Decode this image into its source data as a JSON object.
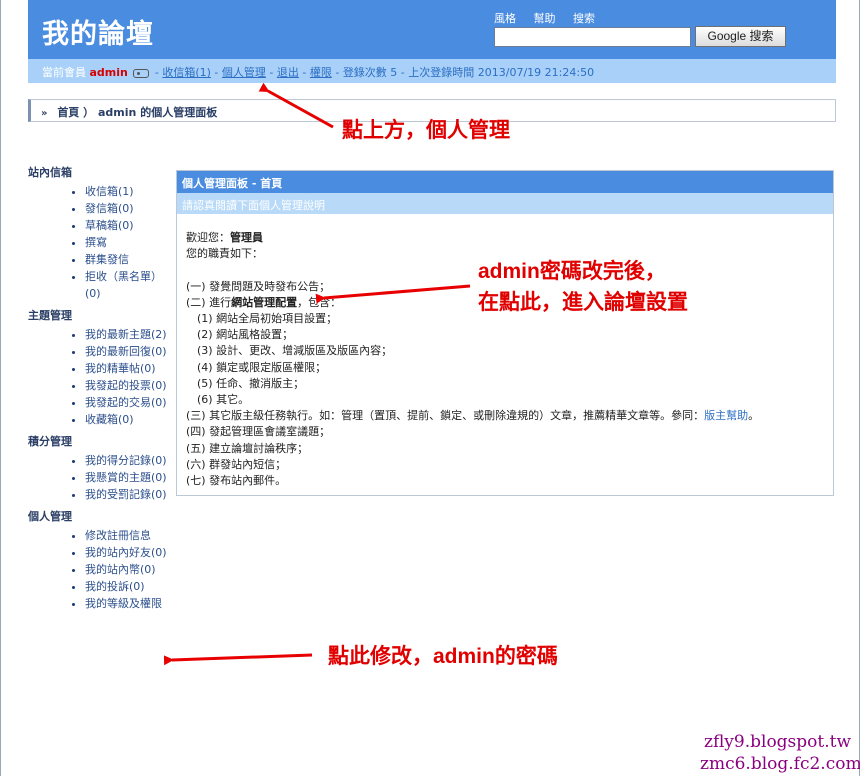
{
  "header": {
    "site_title": "我的論壇",
    "links": [
      "風格",
      "幫助",
      "搜索"
    ],
    "search_placeholder": "",
    "search_button": "Google 搜索"
  },
  "userbar": {
    "prefix": "當前會員",
    "username": "admin",
    "inbox": "收信箱(1)",
    "personal": "個人管理",
    "logout": "退出",
    "permissions": "權限",
    "login_count": "登錄次數 5",
    "last_login": "上次登錄時間 2013/07/19 21:24:50",
    "sep": " - "
  },
  "breadcrumb": {
    "chevron": "»",
    "home": "首頁",
    "sep": "）",
    "title": "admin 的個人管理面板"
  },
  "sidebar": {
    "sections": [
      {
        "title": "站內信箱",
        "items": [
          "收信箱(1)",
          "發信箱(0)",
          "草稿箱(0)",
          "撰寫",
          "群集發信",
          "拒收（黑名單）(0)"
        ]
      },
      {
        "title": "主題管理",
        "items": [
          "我的最新主題(2)",
          "我的最新回復(0)",
          "我的精華帖(0)",
          "我發起的投票(0)",
          "我發起的交易(0)",
          "收藏箱(0)"
        ]
      },
      {
        "title": "積分管理",
        "items": [
          "我的得分記錄(0)",
          "我懸賞的主題(0)",
          "我的受罰記錄(0)"
        ]
      },
      {
        "title": "個人管理",
        "items": [
          "修改註冊信息",
          "我的站內好友(0)",
          "我的站內幣(0)",
          "我的投訴(0)",
          "我的等級及權限"
        ]
      }
    ]
  },
  "panel": {
    "title": "個人管理面板 - 首頁",
    "subtitle": "請認真閱讀下面個人管理說明",
    "welcome_prefix": "歡迎您：",
    "welcome_role": "管理員",
    "duties_intro": "您的職責如下：",
    "lines": [
      "(一) 發覺問題及時發布公告；",
      "(二) 進行網站管理配置，包含：",
      "(1) 網站全局初始項目設置；",
      "(2) 網站風格設置；",
      "(3) 設計、更改、增減版區及版區內容；",
      "(4) 鎖定或限定版區權限；",
      "(5) 任命、撤消版主；",
      "(6) 其它。",
      "(三) 其它版主級任務執行。如：管理（置頂、提前、鎖定、或刪除違規的）文章，推薦精華文章等。參同：",
      "(四) 發起管理區會議室議題；",
      "(五) 建立論壇討論秩序；",
      "(六) 群發站內短信；",
      "(七) 發布站內郵件。"
    ],
    "help_link": "版主幫助",
    "help_end": "。",
    "config_link": "網站管理配置"
  },
  "annotations": {
    "a1": "點上方，個人管理",
    "a2_line1": "admin密碼改完後，",
    "a2_line2": "在點此，進入論壇設置",
    "a3": "點此修改，admin的密碼"
  },
  "watermarks": [
    "zfly9.blogspot.tw",
    "zmc6.blog.fc2.com"
  ],
  "colors": {
    "header": "#4a8ce0",
    "userbar": "#a8d0f8",
    "annotation": "#e00000",
    "watermark": "#8b0080"
  }
}
